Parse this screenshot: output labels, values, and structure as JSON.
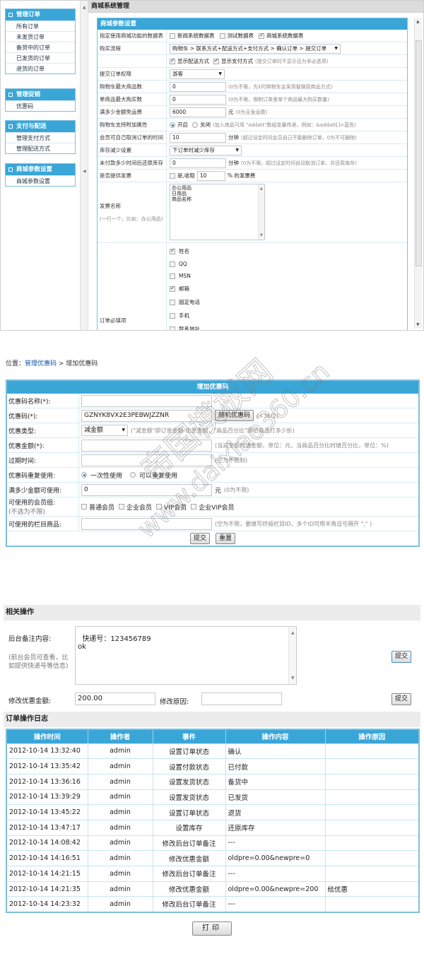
{
  "admin": {
    "sidebar": [
      {
        "title": "管理订单",
        "items": [
          "所有订单",
          "未发货订单",
          "备货中的订单",
          "已发货的订单",
          "退货的订单"
        ]
      },
      {
        "title": "管理促销",
        "items": [
          "优惠码"
        ]
      },
      {
        "title": "支付与配送",
        "items": [
          "管理支付方式",
          "管理配送方式"
        ]
      },
      {
        "title": "商城参数设置",
        "items": [
          "商城参数设置"
        ]
      }
    ],
    "main_title": "商城系统管理",
    "panel_title": "商城参数设置",
    "rows": {
      "tables": {
        "label": "指定使用商城功能的数据表",
        "options": [
          {
            "label": "新闻系统数据表",
            "checked": false
          },
          {
            "label": "测试数据表",
            "checked": false
          },
          {
            "label": "商城系统数据表",
            "checked": true
          }
        ]
      },
      "flow": {
        "label": "购买流程",
        "value": "购物车 > 联系方式+配送方式+支付方式 > 确认订单 > 提交订单"
      },
      "flow_opts": {
        "options": [
          {
            "label": "显示配送方式",
            "checked": true
          },
          {
            "label": "显示支付方式",
            "checked": true
          }
        ],
        "hint": "(提交订单时不显示且为非必选项)"
      },
      "perm": {
        "label": "提交订单权限",
        "value": "游客"
      },
      "cart_max": {
        "label": "购物车最大商品数",
        "value": "0",
        "hint": "(0为不限，为1时购物车会采用替换原商品方式)"
      },
      "item_max": {
        "label": "单商品最大购买数",
        "value": "0",
        "hint": "(0为不限，限制订单里单个商品最大购买数量)"
      },
      "free_ship": {
        "label": "满多少金额免运费",
        "value": "6000",
        "unit": "元",
        "hint": "(0为无免运费)"
      },
      "attr": {
        "label": "购物车支持附加属性",
        "on_label": "开启",
        "off_label": "关闭",
        "selected": "on",
        "hint": "(加入商品可用 \"addatt\"数组变量传递，例如：&addatt[]=蓝色)"
      },
      "cancel_time": {
        "label": "会员可自己取消订单的时间",
        "value": "10",
        "unit": "分钟",
        "hint": "(超过设定时间会员自己不能删除订单，0为不可删除)"
      },
      "stock": {
        "label": "库存减少设置",
        "value": "下订单时减少库存"
      },
      "restore": {
        "label": "未付款多少时间后还原库存",
        "value": "0",
        "unit": "分钟",
        "hint": "(0为不限，超过设定时间自动取消订单，并还原库存)"
      },
      "invoice": {
        "label": "是否提供发票",
        "check_label": "是,收取",
        "checked": false,
        "value": "10",
        "suffix": "% 的发票费"
      },
      "invoice_name": {
        "label": "发票名称",
        "hint": "(一行一个，比如：办公用品)",
        "value": "办公用品\n日用品\n商品名称"
      },
      "required": {
        "label": "订单必填项",
        "options": [
          {
            "label": "姓名",
            "checked": true
          },
          {
            "label": "QQ",
            "checked": false
          },
          {
            "label": "MSN",
            "checked": false
          },
          {
            "label": "邮箱",
            "checked": true
          },
          {
            "label": "固定电话",
            "checked": false
          },
          {
            "label": "手机",
            "checked": false
          },
          {
            "label": "联系地址",
            "checked": false
          }
        ]
      }
    }
  },
  "coupon": {
    "breadcrumb": {
      "prefix": "位置：",
      "link": "管理优惠码",
      "sep": " > ",
      "current": "增加优惠码"
    },
    "title": "增加优惠码",
    "name": {
      "label": "优惠码名称(*):",
      "value": ""
    },
    "code": {
      "label": "优惠码(*):",
      "value": "GZNYK8VX2E3PEBWJZZNR",
      "button": "随机优惠码",
      "hint": "(<36位)"
    },
    "type": {
      "label": "优惠类型:",
      "value": "减金额",
      "hint": "(\"减金额\"即订单金额-优惠金额，\"商品百分比\"即给商品打多少折)"
    },
    "amount": {
      "label": "优惠金额(*):",
      "value": "",
      "hint": "(当减金额时填金额，单位：元，当商品百分比时填百分比，单位：%)"
    },
    "expire": {
      "label": "过期时间:",
      "value": "",
      "hint": "(空为不限制)"
    },
    "reuse": {
      "label": "优惠码重复使用:",
      "options": [
        "一次性使用",
        "可以重复使用"
      ],
      "selected": 0
    },
    "min_amount": {
      "label": "满多少金额可使用:",
      "value": "0",
      "unit": "元",
      "hint": "(0为不限)"
    },
    "groups": {
      "label": "可使用的会员组:",
      "sub": "(不选为不限)",
      "options": [
        "普通会员",
        "企业会员",
        "VIP会员",
        "企业VIP会员"
      ]
    },
    "columns": {
      "label": "可使用的栏目商品:",
      "value": "",
      "hint": "(空为不限，要填写终极栏目ID，多个ID可用半角逗号隔开 \",\" )"
    },
    "submit": "提交",
    "reset": "重置"
  },
  "watermark": [
    "帝国模板网",
    "www.daixiao360.cn"
  ],
  "related": {
    "title": "相关操作",
    "note_label": "后台备注内容:",
    "note_hint": "(前台会员可查看，比如提供快递号等信息)",
    "note_value": "快递号：123456789\nok",
    "submit1": "提交",
    "discount_label": "修改优惠金额:",
    "discount_value": "200.00",
    "reason_label": "修改原因:",
    "reason_value": "",
    "submit2": "提交"
  },
  "log": {
    "title": "订单操作日志",
    "headers": [
      "操作时间",
      "操作者",
      "事件",
      "操作内容",
      "操作原因"
    ],
    "rows": [
      [
        "2012-10-14 13:32:40",
        "admin",
        "设置订单状态",
        "确认",
        ""
      ],
      [
        "2012-10-14 13:35:42",
        "admin",
        "设置付款状态",
        "已付款",
        ""
      ],
      [
        "2012-10-14 13:36:16",
        "admin",
        "设置发货状态",
        "备货中",
        ""
      ],
      [
        "2012-10-14 13:39:29",
        "admin",
        "设置发货状态",
        "已发货",
        ""
      ],
      [
        "2012-10-14 13:45:22",
        "admin",
        "设置订单状态",
        "退货",
        ""
      ],
      [
        "2012-10-14 13:47:17",
        "admin",
        "设置库存",
        "还原库存",
        ""
      ],
      [
        "2012-10-14 14:08:42",
        "admin",
        "修改后台订单备注",
        "---",
        ""
      ],
      [
        "2012-10-14 14:16:51",
        "admin",
        "修改优惠金额",
        "oldpre=0.00&newpre=0",
        ""
      ],
      [
        "2012-10-14 14:21:15",
        "admin",
        "修改后台订单备注",
        "---",
        ""
      ],
      [
        "2012-10-14 14:21:35",
        "admin",
        "修改优惠金额",
        "oldpre=0.00&newpre=200",
        "给优惠"
      ],
      [
        "2012-10-14 14:23:32",
        "admin",
        "修改后台订单备注",
        "---",
        ""
      ]
    ],
    "print": "打印"
  }
}
